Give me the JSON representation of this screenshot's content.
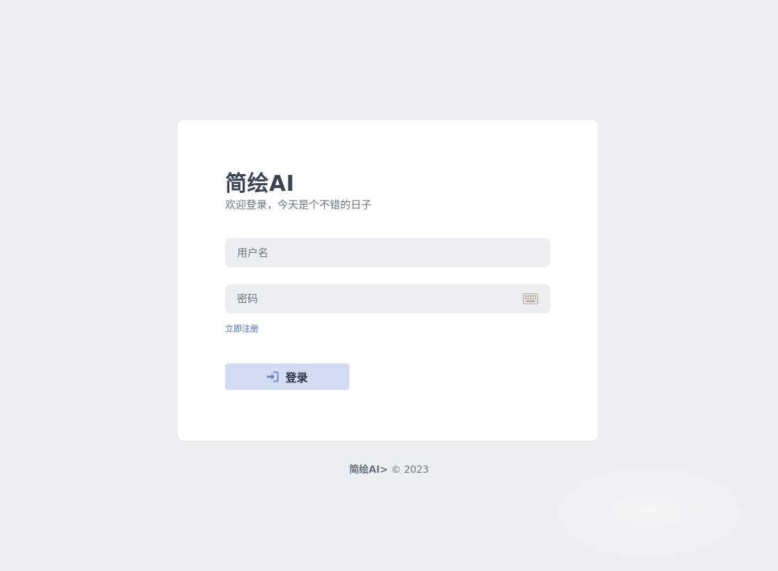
{
  "login": {
    "title": "简绘AI",
    "subtitle": "欢迎登录，今天是个不错的日子",
    "username": {
      "value": "",
      "placeholder": "用户名"
    },
    "password": {
      "value": "",
      "placeholder": "密码",
      "icon": "keyboard-icon"
    },
    "register_link": "立即注册",
    "submit": {
      "label": "登录",
      "icon": "login-arrow-icon"
    }
  },
  "footer": {
    "brand": "简绘AI>",
    "copyright": "© 2023"
  },
  "colors": {
    "background": "#eceef1",
    "card": "#ffffff",
    "title": "#3b4355",
    "input_bg": "#eceef1",
    "link": "#4f6fb0",
    "button_bg": "#d1dcf3",
    "button_text": "#2a3347"
  }
}
